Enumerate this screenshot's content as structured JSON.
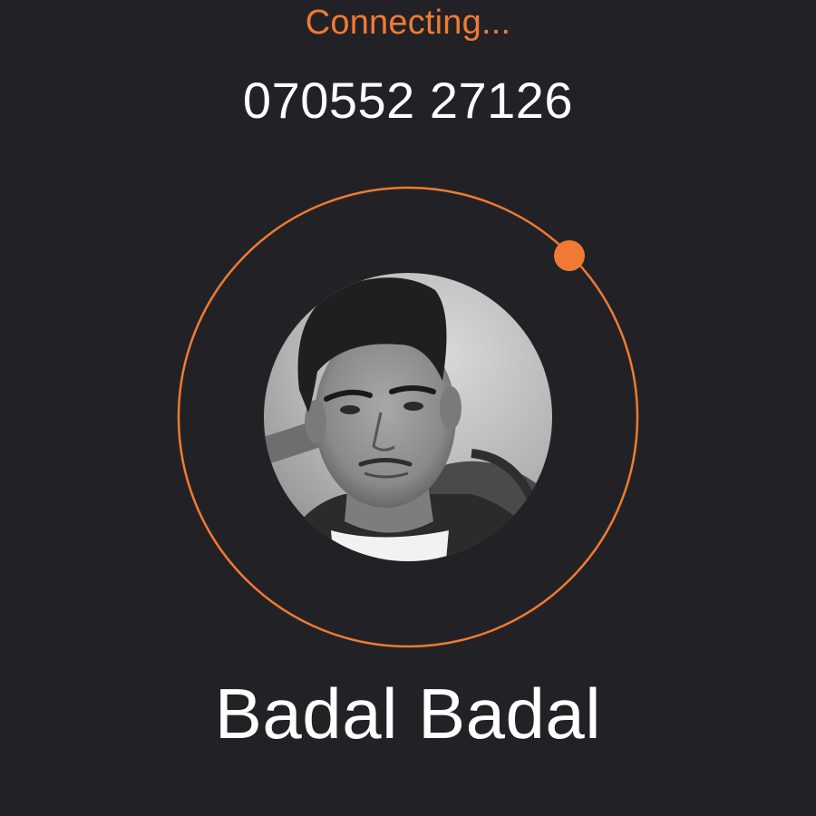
{
  "call": {
    "status": "Connecting...",
    "number": "070552 27126",
    "contact_name": "Badal Badal"
  },
  "colors": {
    "background": "#222226",
    "accent": "#f07a33",
    "text": "#ffffff"
  },
  "avatar": {
    "icon": "contact-photo",
    "style": "grayscale portrait"
  }
}
